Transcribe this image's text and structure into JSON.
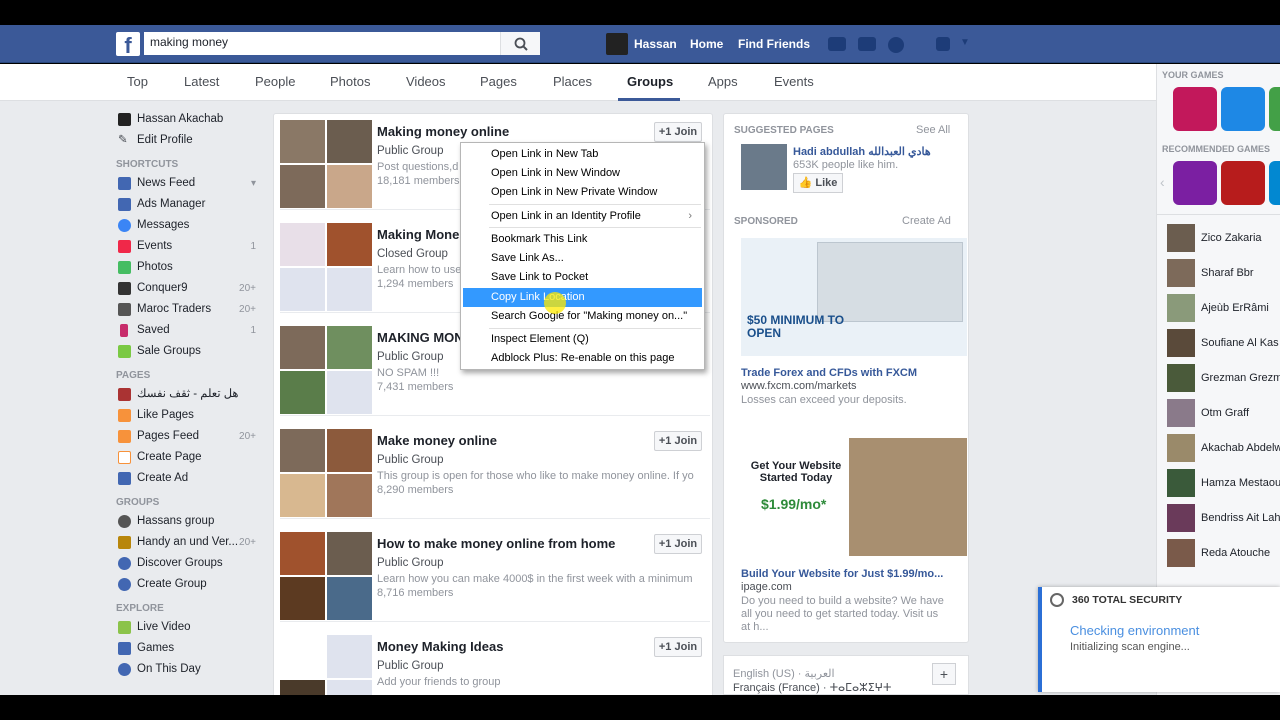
{
  "search": {
    "value": "making money"
  },
  "topnav": {
    "user": "Hassan",
    "home": "Home",
    "find_friends": "Find Friends"
  },
  "tabs": [
    "Top",
    "Latest",
    "People",
    "Photos",
    "Videos",
    "Pages",
    "Places",
    "Groups",
    "Apps",
    "Events"
  ],
  "leftnav": {
    "profile": "Hassan Akachab",
    "edit_profile": "Edit Profile",
    "shortcuts_head": "SHORTCUTS",
    "shortcuts": [
      {
        "label": "News Feed",
        "count": ""
      },
      {
        "label": "Ads Manager",
        "count": ""
      },
      {
        "label": "Messages",
        "count": ""
      },
      {
        "label": "Events",
        "count": "1"
      },
      {
        "label": "Photos",
        "count": ""
      },
      {
        "label": "Conquer9",
        "count": "20+"
      },
      {
        "label": "Maroc Traders",
        "count": "20+"
      },
      {
        "label": "Saved",
        "count": "1"
      },
      {
        "label": "Sale Groups",
        "count": ""
      }
    ],
    "pages_head": "PAGES",
    "pages": [
      {
        "label": "هل تعلم - ثقف نفسك",
        "count": ""
      },
      {
        "label": "Like Pages",
        "count": ""
      },
      {
        "label": "Pages Feed",
        "count": "20+"
      },
      {
        "label": "Create Page",
        "count": ""
      },
      {
        "label": "Create Ad",
        "count": ""
      }
    ],
    "groups_head": "GROUPS",
    "groups": [
      {
        "label": "Hassans group",
        "count": ""
      },
      {
        "label": "Handy an und Ver...",
        "count": "20+"
      },
      {
        "label": "Discover Groups",
        "count": ""
      },
      {
        "label": "Create Group",
        "count": ""
      }
    ],
    "explore_head": "EXPLORE",
    "explore": [
      {
        "label": "Live Video",
        "count": ""
      },
      {
        "label": "Games",
        "count": ""
      },
      {
        "label": "On This Day",
        "count": ""
      }
    ]
  },
  "results": [
    {
      "title": "Making money online",
      "type": "Public Group",
      "desc": "Post questions,d",
      "members": "18,181 members",
      "join": "Join"
    },
    {
      "title": "Making Mone",
      "type": "Closed Group",
      "desc": "Learn how to use",
      "members": "1,294 members",
      "join": ""
    },
    {
      "title": "MAKING MON",
      "type": "Public Group",
      "desc": "NO SPAM !!!",
      "members": "7,431 members",
      "join": ""
    },
    {
      "title": "Make money online",
      "type": "Public Group",
      "desc": "This group is open for those who like to make money online. If yo",
      "members": "8,290 members",
      "join": "Join"
    },
    {
      "title": "How to make money online from home",
      "type": "Public Group",
      "desc": "Learn how you can make 4000$ in the first week with a minimum",
      "members": "8,716 members",
      "join": "Join"
    },
    {
      "title": "Money Making Ideas",
      "type": "Public Group",
      "desc": "Add your friends to group",
      "members": "",
      "join": "Join"
    }
  ],
  "context_menu": [
    "Open Link in New Tab",
    "Open Link in New Window",
    "Open Link in New Private Window",
    "Open Link in an Identity Profile",
    "Bookmark This Link",
    "Save Link As...",
    "Save Link to Pocket",
    "Copy Link Location",
    "Search Google for \"Making money on...\"",
    "Inspect Element (Q)",
    "Adblock Plus: Re-enable on this page"
  ],
  "suggested": {
    "head": "SUGGESTED PAGES",
    "see_all": "See All",
    "page_name": "Hadi abdullah هادي العبدالله",
    "likes": "653K people like him.",
    "like_btn": "Like"
  },
  "sponsored": {
    "head": "SPONSORED",
    "create_ad": "Create Ad",
    "ad1_banner": "$50 MINIMUM TO OPEN",
    "ad1_title": "Trade Forex and CFDs with FXCM",
    "ad1_url": "www.fxcm.com/markets",
    "ad1_desc": "Losses can exceed your deposits.",
    "ad2_banner": "Get Your Website Started Today",
    "ad2_price": "$1.99/mo*",
    "ad2_title": "Build Your Website for Just $1.99/mo...",
    "ad2_url": "ipage.com",
    "ad2_desc1": "Do you need to build a website? We have",
    "ad2_desc2": "all you need to get started today. Visit us",
    "ad2_desc3": "at h..."
  },
  "languages": {
    "line1": "English (US) · العربية",
    "line2": "Français (France) · ⵜⴰⵎⴰⵣⵉⵖⵜ"
  },
  "games": {
    "your_games": "YOUR GAMES",
    "recommended": "RECOMMENDED GAMES"
  },
  "friends": [
    "Zico Zakaria",
    "Sharaf Bbr",
    "Ajeùb ErRâmi",
    "Soufiane Al Kas",
    "Grezman Grezm",
    "Otm Graff",
    "Akachab Abdelw",
    "Hamza Mestaou",
    "Bendriss Ait Lah",
    "Reda Atouche"
  ],
  "security": {
    "brand": "360 TOTAL SECURITY",
    "line1": "Checking environment",
    "line2": "Initializing scan engine..."
  }
}
